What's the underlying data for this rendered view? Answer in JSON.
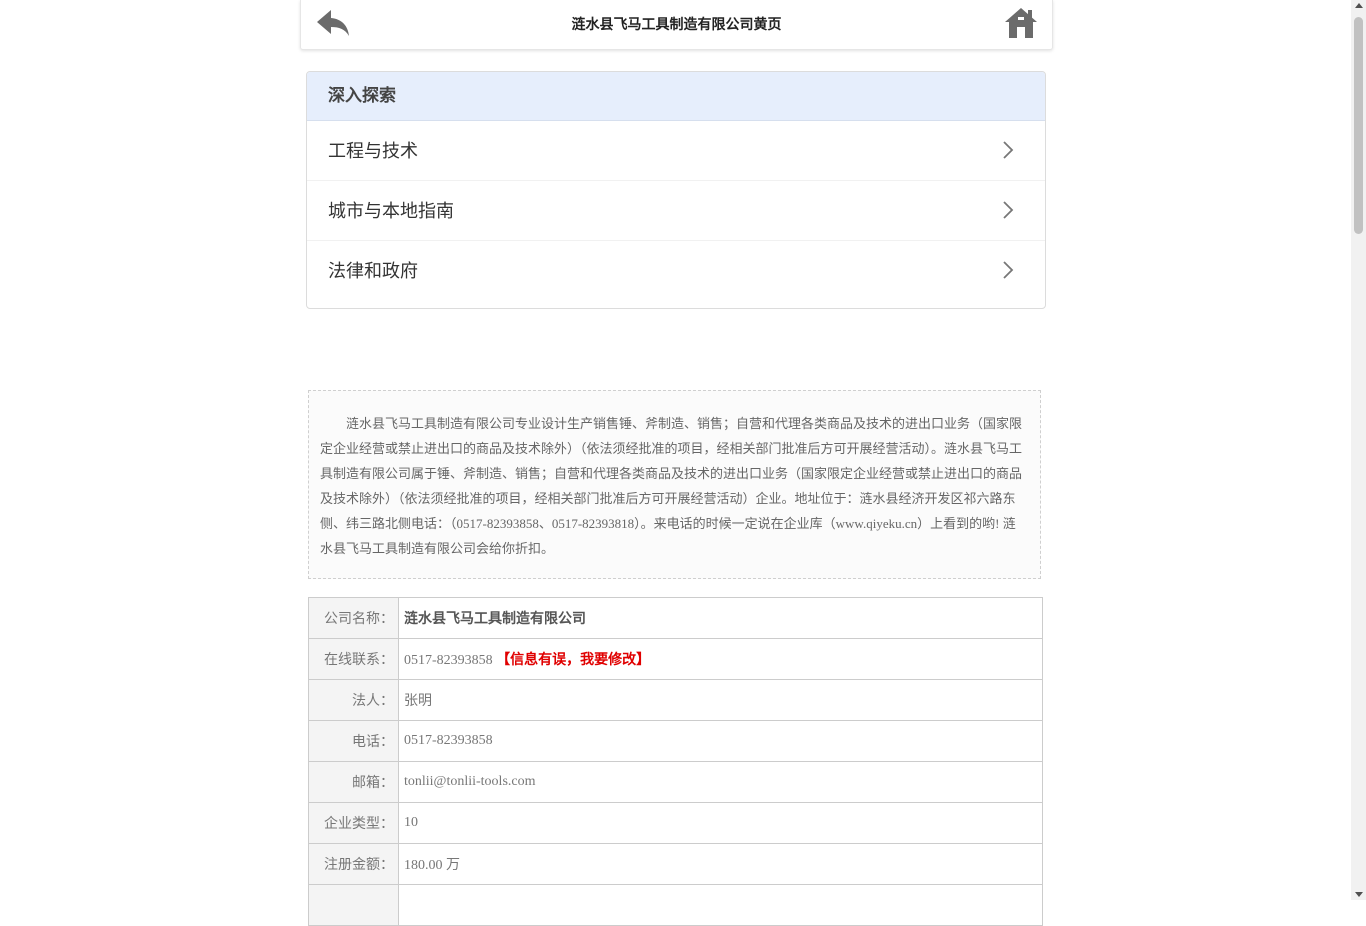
{
  "header": {
    "title": "涟水县飞马工具制造有限公司黄页",
    "back_icon": "back-arrow-icon",
    "home_icon": "home-icon"
  },
  "explore": {
    "title": "深入探索",
    "items": [
      {
        "label": "工程与技术"
      },
      {
        "label": "城市与本地指南"
      },
      {
        "label": "法律和政府"
      }
    ]
  },
  "description": "涟水县飞马工具制造有限公司专业设计生产销售锤、斧制造、销售；自营和代理各类商品及技术的进出口业务（国家限定企业经营或禁止进出口的商品及技术除外）（依法须经批准的项目，经相关部门批准后方可开展经营活动）。涟水县飞马工具制造有限公司属于锤、斧制造、销售；自营和代理各类商品及技术的进出口业务（国家限定企业经营或禁止进出口的商品及技术除外）（依法须经批准的项目，经相关部门批准后方可开展经营活动）企业。地址位于：涟水县经济开发区祁六路东侧、纬三路北侧电话：（0517-82393858、0517-82393818）。来电话的时候一定说在企业库（www.qiyeku.cn）上看到的哟! 涟水县飞马工具制造有限公司会给你折扣。",
  "info": {
    "company_label": "公司名称：",
    "company_value": "涟水县飞马工具制造有限公司",
    "contact_label": "在线联系：",
    "contact_value": "0517-82393858",
    "contact_fix": "【信息有误，我要修改】",
    "legal_label": "法人：",
    "legal_value": "张明",
    "phone_label": "电话：",
    "phone_value": "0517-82393858",
    "email_label": "邮箱：",
    "email_value": "tonlii@tonlii-tools.com",
    "type_label": "企业类型：",
    "type_value": "10",
    "capital_label": "注册金额：",
    "capital_value": "180.00 万"
  },
  "colors": {
    "panel_header_bg": "#e6eefc",
    "alert_red": "#e00000",
    "border": "#cccccc"
  }
}
